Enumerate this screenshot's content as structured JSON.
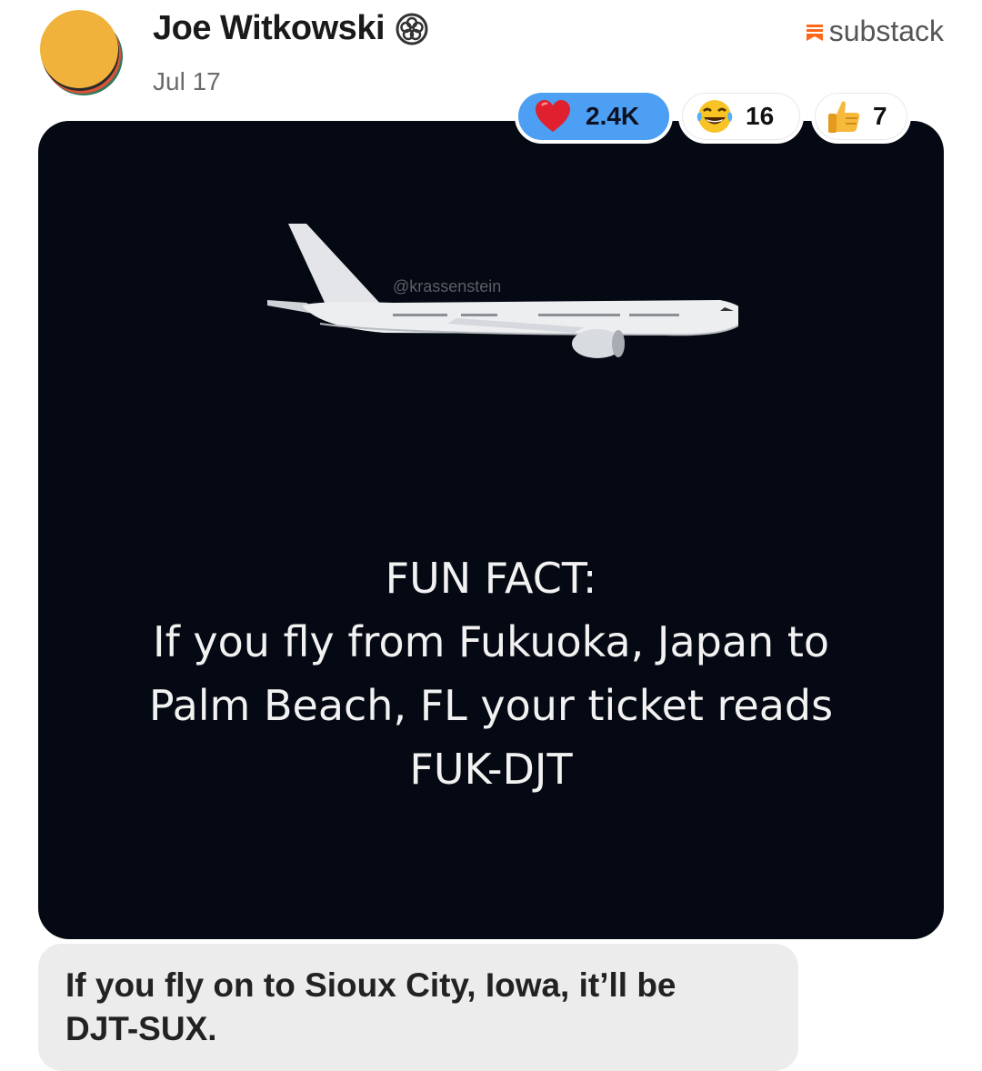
{
  "author": {
    "name": "Joe Witkowski",
    "verified_icon": "verified-badge-icon",
    "date": "Jul 17",
    "avatar_colors": [
      "#f0b23a",
      "#2f7a5a",
      "#d9543a",
      "#3a3a3a"
    ]
  },
  "brand": {
    "label": "substack",
    "icon": "substack-logo-icon",
    "color": "#ff6719"
  },
  "post": {
    "watermark": "@krassenstein",
    "lines": [
      "FUN FACT:",
      "If you fly from Fukuoka, Japan to",
      "Palm Beach, FL your ticket reads",
      "FUK-DJT"
    ],
    "background": "#050913"
  },
  "reactions": [
    {
      "icon": "red-heart-icon",
      "count": "2.4K",
      "selected": true,
      "color": "#4c9ff2"
    },
    {
      "icon": "tears-of-joy-icon",
      "count": "16",
      "selected": false
    },
    {
      "icon": "thumbs-up-icon",
      "count": "7",
      "selected": false
    }
  ],
  "reply": {
    "text_line1": "If you fly on to Sioux City, Iowa, it’ll be",
    "text_line2": "DJT-SUX."
  }
}
